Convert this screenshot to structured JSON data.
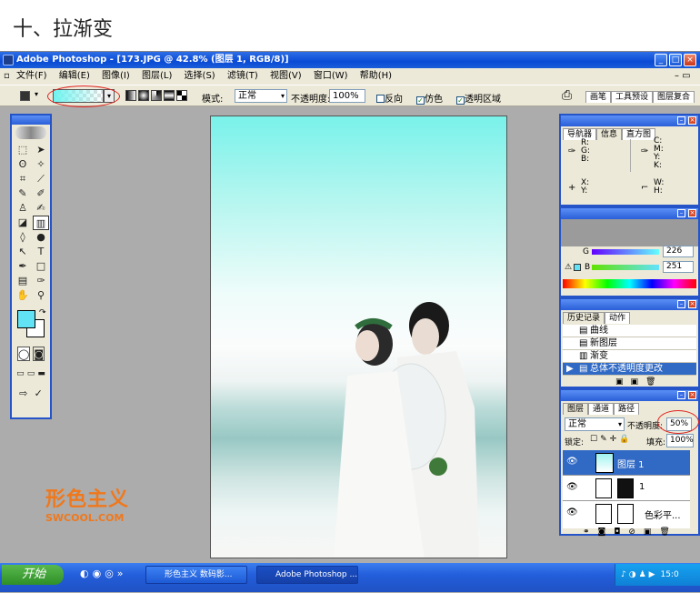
{
  "heading": "十、拉渐变",
  "app": {
    "title": "Adobe Photoshop - [173.JPG @ 42.8% (图层 1, RGB/8)]"
  },
  "menu": [
    "文件(F)",
    "编辑(E)",
    "图像(I)",
    "图层(L)",
    "选择(S)",
    "滤镜(T)",
    "视图(V)",
    "窗口(W)",
    "帮助(H)"
  ],
  "options": {
    "mode_label": "模式:",
    "mode_value": "正常",
    "opacity_label": "不透明度:",
    "opacity_value": "100%",
    "reverse_label": "反向",
    "dither_label": "仿色",
    "transparency_label": "透明区域",
    "tabs": [
      "画笔",
      "工具预设",
      "图层复合"
    ]
  },
  "navigator": {
    "tabs": [
      "导航器",
      "信息",
      "直方图"
    ],
    "rgb": [
      "R:",
      "G:",
      "B:"
    ],
    "cmyk": [
      "C:",
      "M:",
      "Y:",
      "K:"
    ],
    "xy": [
      "X:",
      "Y:"
    ],
    "wh": [
      "W:",
      "H:"
    ]
  },
  "color": {
    "g_label": "G",
    "g_value": "226",
    "b_label": "B",
    "b_value": "251"
  },
  "history": {
    "tabs": [
      "历史记录",
      "动作"
    ],
    "items": [
      "曲线",
      "新图层",
      "渐变",
      "总体不透明度更改"
    ]
  },
  "layers": {
    "tabs": [
      "图层",
      "通道",
      "路径"
    ],
    "blend_mode": "正常",
    "opacity_label": "不透明度:",
    "opacity_value": "50%",
    "lock_label": "锁定:",
    "fill_label": "填充:",
    "fill_value": "100%",
    "items": [
      "图层 1",
      "1",
      "色彩平..."
    ]
  },
  "watermark": {
    "cn": "形色主义",
    "en": "SWCOOL.COM"
  },
  "taskbar": {
    "start": "开始",
    "items": [
      "形色主义 数码影...",
      "Adobe Photoshop ..."
    ],
    "time": "15:0"
  },
  "colors": {
    "foreground": "#62e2f5",
    "gradient_start": "#6ff4f0",
    "selection": "#316ac5",
    "annotation": "#e0201c"
  }
}
